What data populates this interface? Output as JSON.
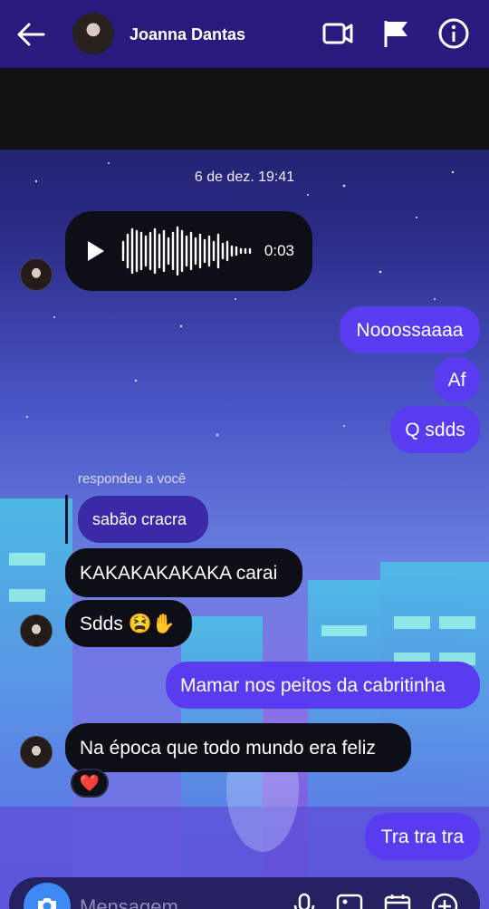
{
  "header": {
    "title": "Joanna Dantas",
    "icons": [
      "back-arrow-icon",
      "video-call-icon",
      "flag-icon",
      "info-icon"
    ]
  },
  "timestamp": "6 de dez. 19:41",
  "audio": {
    "duration": "0:03"
  },
  "messages": {
    "m1": "Nooossaaaa",
    "m2": "Af",
    "m3": "Q sdds",
    "reply_label": "respondeu a você",
    "quoted": "sabão cracra",
    "m4": "KAKAKAKAKAKA carai",
    "m5": "Sdds 😫✋",
    "m6": "Mamar nos peitos da cabritinha",
    "m7": "Na época que todo mundo era feliz",
    "reaction": "❤️",
    "m8": "Tra tra tra"
  },
  "composer": {
    "placeholder": "Mensagem..."
  },
  "colors": {
    "header": "#2b1a7e",
    "sent_bubble": "#5a3cf0",
    "received_bubble": "#0e0e16"
  }
}
